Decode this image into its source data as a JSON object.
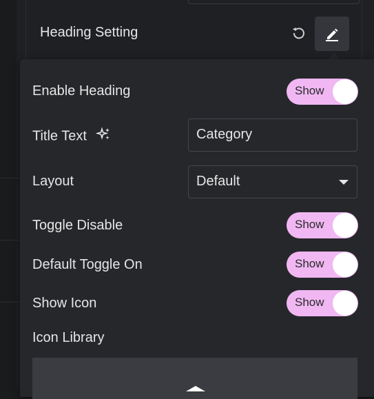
{
  "section": {
    "title": "Heading Setting",
    "reset_icon": "reset-icon",
    "edit_icon": "edit-pencil-icon"
  },
  "settings": {
    "enable_heading": {
      "label": "Enable Heading",
      "toggle_text": "Show",
      "on": true
    },
    "title_text": {
      "label": "Title Text",
      "ai_icon": "sparkle-icon",
      "value": "Category"
    },
    "layout": {
      "label": "Layout",
      "value": "Default"
    },
    "toggle_disable": {
      "label": "Toggle Disable",
      "toggle_text": "Show",
      "on": true
    },
    "default_toggle_on": {
      "label": "Default Toggle On",
      "toggle_text": "Show",
      "on": true
    },
    "show_icon": {
      "label": "Show Icon",
      "toggle_text": "Show",
      "on": true
    },
    "icon_library": {
      "label": "Icon Library"
    }
  },
  "colors": {
    "toggle_on": "#f0b7f2",
    "panel": "#26272b",
    "text": "#e6e6e6"
  }
}
